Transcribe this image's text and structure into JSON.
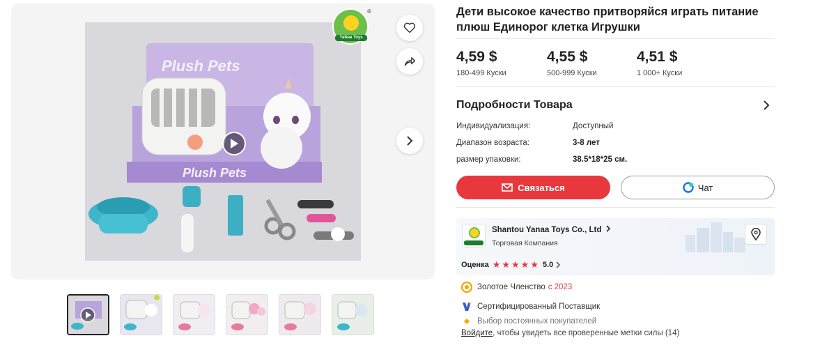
{
  "gallery": {
    "logo_text": "YaNaa Toys",
    "logo_reg": "®",
    "box_text": "Plush Pets",
    "thumbnail_count": 6
  },
  "product": {
    "title": "Дети высокое качество притворяйся играть питание плюш Единорог клетка Игрушки"
  },
  "prices": [
    {
      "price": "4,59 $",
      "qty": "180-499 Куски"
    },
    {
      "price": "4,55 $",
      "qty": "500-999 Куски"
    },
    {
      "price": "4,51 $",
      "qty": "1 000+ Куски"
    }
  ],
  "details": {
    "title": "Подробности Товара",
    "rows": [
      {
        "key": "Индивидуализация:",
        "value": "Доступный"
      },
      {
        "key": "Диапазон возраста:",
        "value": "3-8 лет"
      },
      {
        "key": "размер упаковки:",
        "value": "38.5*18*25 см."
      }
    ]
  },
  "actions": {
    "contact_label": "Связаться",
    "chat_label": "Чат"
  },
  "supplier": {
    "name": "Shantou Yanaa Toys Co., Ltd",
    "type": "Торговая Компания",
    "rating_label": "Оценка",
    "rating_value": "5.0",
    "stars": 5
  },
  "badges": {
    "gold_label": "Золотое Членство",
    "gold_since": "с 2023",
    "verified_label": "Сертифицированный Поставщик",
    "repeat_label": "Выбор постоянных покупателей",
    "login_link": "Войдите",
    "login_rest": ", чтобы увидеть все проверенные метки силы (14)"
  },
  "colors": {
    "accent_red": "#e8383d",
    "brand_green": "#6cc04a",
    "gold": "#f2a900",
    "verified_blue": "#2f5fd0"
  }
}
